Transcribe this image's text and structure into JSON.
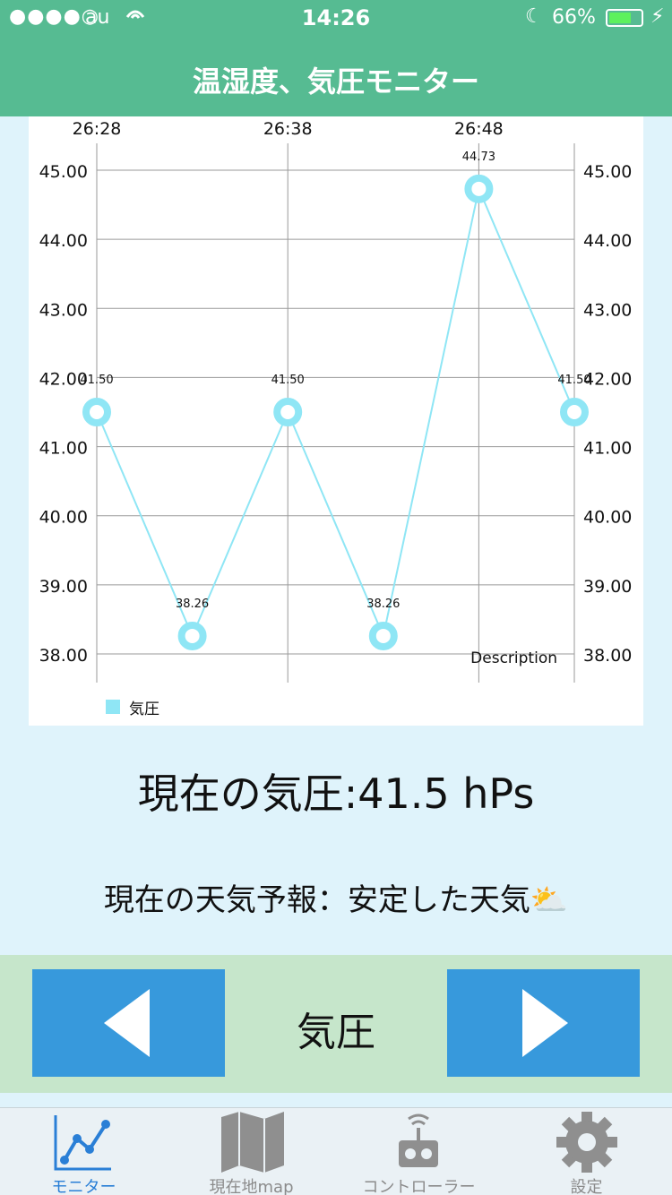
{
  "status_bar": {
    "signal": "●●●●○",
    "carrier": "au",
    "time": "14:26",
    "battery": "66%"
  },
  "header": {
    "title": "温湿度、気圧モニター"
  },
  "chart_data": {
    "type": "line",
    "x_tick_labels": [
      "26:28",
      "26:38",
      "26:48"
    ],
    "x": [
      0,
      1,
      2,
      3,
      4,
      5
    ],
    "y_ticks": [
      "38.00",
      "39.00",
      "40.00",
      "41.00",
      "42.00",
      "43.00",
      "44.00",
      "45.00"
    ],
    "ylim": [
      38,
      45
    ],
    "series": [
      {
        "name": "気圧",
        "values": [
          41.5,
          38.26,
          41.5,
          38.26,
          44.73,
          41.5
        ],
        "labels": [
          "41.50",
          "38.26",
          "41.50",
          "38.26",
          "44.73",
          "41.50"
        ],
        "color": "#8fe6f5"
      }
    ],
    "description": "Description",
    "legend_label": "気圧",
    "grid": true,
    "legend_position": "bottom-left"
  },
  "readings": {
    "pressure": "現在の気圧:41.5 hPs",
    "forecast": "現在の天気予報：安定した天気⛅"
  },
  "controls": {
    "label": "気圧",
    "button_color": "#3799dc"
  },
  "tabbar": {
    "tabs": [
      {
        "label": "モニター",
        "icon": "chart-icon",
        "active": true
      },
      {
        "label": "現在地map",
        "icon": "map-icon",
        "active": false
      },
      {
        "label": "コントローラー",
        "icon": "controller-icon",
        "active": false
      },
      {
        "label": "設定",
        "icon": "gear-icon",
        "active": false
      }
    ]
  },
  "colors": {
    "header": "#56bb92",
    "background": "#dff3fb",
    "controls": "#c6e6cb",
    "accent": "#2a7fd6"
  }
}
